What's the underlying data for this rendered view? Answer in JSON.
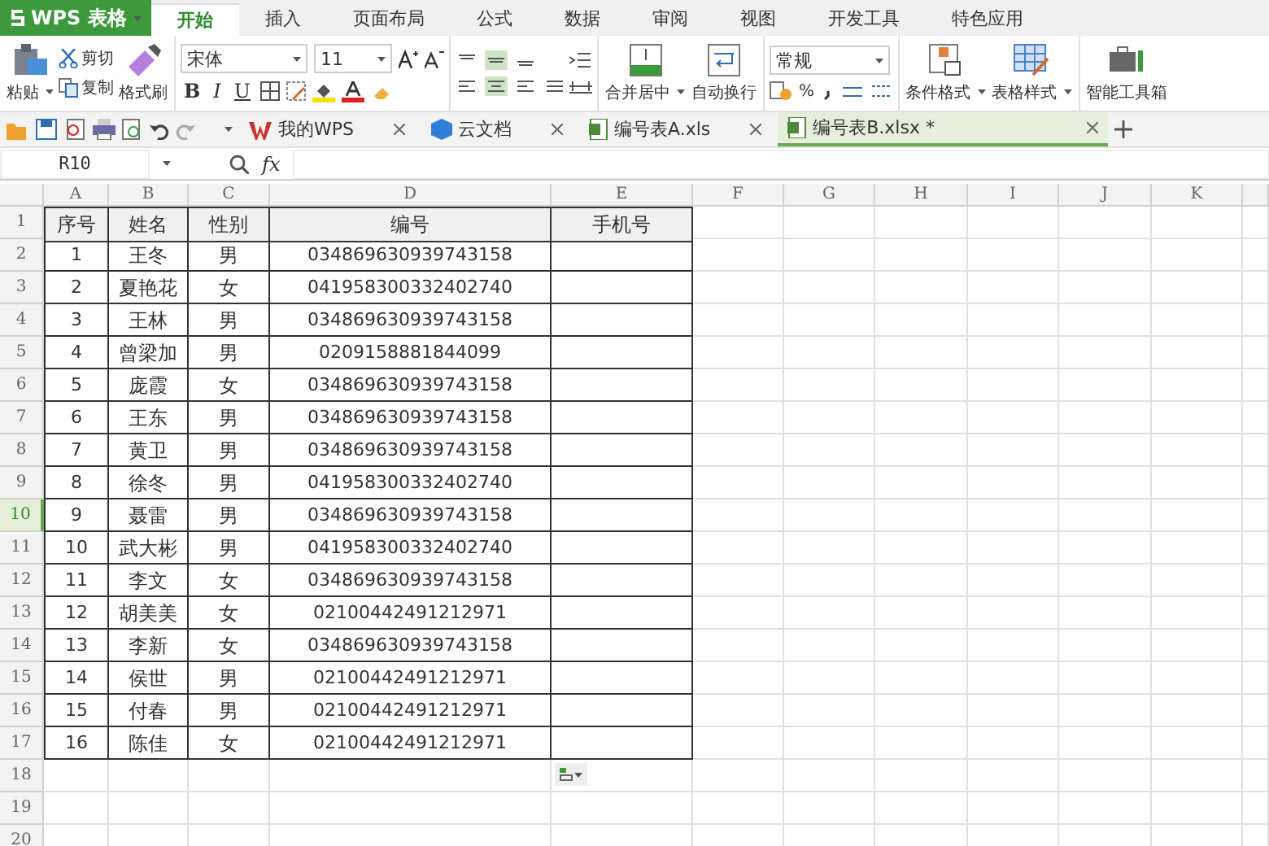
{
  "app_menu": {
    "label": "WPS 表格"
  },
  "tabs": [
    {
      "label": "开始",
      "selected": true
    },
    {
      "label": "插入",
      "selected": false
    },
    {
      "label": "页面布局",
      "selected": false
    },
    {
      "label": "公式",
      "selected": false
    },
    {
      "label": "数据",
      "selected": false
    },
    {
      "label": "审阅",
      "selected": false
    },
    {
      "label": "视图",
      "selected": false
    },
    {
      "label": "开发工具",
      "selected": false
    },
    {
      "label": "特色应用",
      "selected": false
    }
  ],
  "ribbon": {
    "paste": "粘贴",
    "cut": "剪切",
    "copy": "复制",
    "format_painter": "格式刷",
    "font_name": "宋体",
    "font_size": "11",
    "bold": "B",
    "italic": "I",
    "underline": "U",
    "merge_center": "合并居中",
    "wrap_text": "自动换行",
    "number_format": "常规",
    "percent": "%",
    "conditional_format": "条件格式",
    "table_style": "表格样式",
    "toolbox": "智能工具箱"
  },
  "doc_tabs": [
    {
      "label": "我的WPS",
      "kind": "wps",
      "selected": false
    },
    {
      "label": "云文档",
      "kind": "cloud",
      "selected": false
    },
    {
      "label": "编号表A.xls",
      "kind": "sheet",
      "selected": false
    },
    {
      "label": "编号表B.xlsx *",
      "kind": "sheet",
      "selected": true
    }
  ],
  "formula_bar": {
    "name_box": "R10",
    "fx": "fx"
  },
  "sheet": {
    "columns": [
      {
        "label": "A",
        "selected": false
      },
      {
        "label": "B",
        "selected": false
      },
      {
        "label": "C",
        "selected": false
      },
      {
        "label": "D",
        "selected": false
      },
      {
        "label": "E",
        "selected": false
      },
      {
        "label": "F",
        "selected": false
      },
      {
        "label": "G",
        "selected": false
      },
      {
        "label": "H",
        "selected": false
      },
      {
        "label": "I",
        "selected": false
      },
      {
        "label": "J",
        "selected": false
      },
      {
        "label": "K",
        "selected": false
      }
    ],
    "rows": [
      {
        "number": "1",
        "selected": false,
        "cells": [
          "序号",
          "姓名",
          "性别",
          "编号",
          "手机号"
        ]
      },
      {
        "number": "2",
        "selected": false,
        "cells": [
          "1",
          "王冬",
          "男",
          "034869630939743158",
          ""
        ]
      },
      {
        "number": "3",
        "selected": false,
        "cells": [
          "2",
          "夏艳花",
          "女",
          "041958300332402740",
          ""
        ]
      },
      {
        "number": "4",
        "selected": false,
        "cells": [
          "3",
          "王林",
          "男",
          "034869630939743158",
          ""
        ]
      },
      {
        "number": "5",
        "selected": false,
        "cells": [
          "4",
          "曾梁加",
          "男",
          "0209158881844099",
          ""
        ]
      },
      {
        "number": "6",
        "selected": false,
        "cells": [
          "5",
          "庞霞",
          "女",
          "034869630939743158",
          ""
        ]
      },
      {
        "number": "7",
        "selected": false,
        "cells": [
          "6",
          "王东",
          "男",
          "034869630939743158",
          ""
        ]
      },
      {
        "number": "8",
        "selected": false,
        "cells": [
          "7",
          "黄卫",
          "男",
          "034869630939743158",
          ""
        ]
      },
      {
        "number": "9",
        "selected": false,
        "cells": [
          "8",
          "徐冬",
          "男",
          "041958300332402740",
          ""
        ]
      },
      {
        "number": "10",
        "selected": true,
        "cells": [
          "9",
          "聂雷",
          "男",
          "034869630939743158",
          ""
        ]
      },
      {
        "number": "11",
        "selected": false,
        "cells": [
          "10",
          "武大彬",
          "男",
          "041958300332402740",
          ""
        ]
      },
      {
        "number": "12",
        "selected": false,
        "cells": [
          "11",
          "李文",
          "女",
          "034869630939743158",
          ""
        ]
      },
      {
        "number": "13",
        "selected": false,
        "cells": [
          "12",
          "胡美美",
          "女",
          "02100442491212971",
          ""
        ]
      },
      {
        "number": "14",
        "selected": false,
        "cells": [
          "13",
          "李新",
          "女",
          "034869630939743158",
          ""
        ]
      },
      {
        "number": "15",
        "selected": false,
        "cells": [
          "14",
          "侯世",
          "男",
          "02100442491212971",
          ""
        ]
      },
      {
        "number": "16",
        "selected": false,
        "cells": [
          "15",
          "付春",
          "男",
          "02100442491212971",
          ""
        ]
      },
      {
        "number": "17",
        "selected": false,
        "cells": [
          "16",
          "陈佳",
          "女",
          "02100442491212971",
          ""
        ]
      },
      {
        "number": "18",
        "selected": false
      },
      {
        "number": "19",
        "selected": false
      },
      {
        "number": "20",
        "selected": false
      }
    ]
  }
}
